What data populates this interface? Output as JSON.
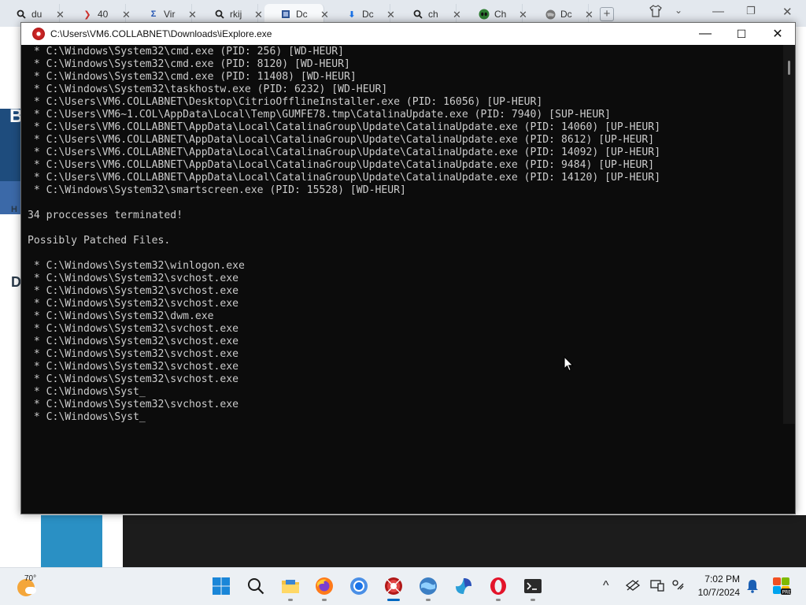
{
  "browser": {
    "tabs": [
      {
        "icon": "search-icon",
        "title": "du",
        "active": false
      },
      {
        "icon": "virustotal-icon",
        "title": "40",
        "active": false
      },
      {
        "icon": "sigma-icon",
        "title": "Vir",
        "active": false
      },
      {
        "icon": "search-icon",
        "title": "rkij",
        "active": false
      },
      {
        "icon": "document-icon",
        "title": "Dc",
        "active": true
      },
      {
        "icon": "download-icon",
        "title": "Dc",
        "active": false
      },
      {
        "icon": "search-icon",
        "title": "ch",
        "active": false
      },
      {
        "icon": "alien-icon",
        "title": "Ch",
        "active": false
      },
      {
        "icon": "globe-icon",
        "title": "Dc",
        "active": false
      }
    ],
    "new_tab_icon": "plus-icon"
  },
  "background_page": {
    "letters": [
      "B",
      "H",
      "D"
    ]
  },
  "console_window": {
    "title": "C:\\Users\\VM6.COLLABNET\\Downloads\\iExplore.exe",
    "controls": {
      "minimize": "—",
      "maximize": "☐",
      "close": "✕"
    },
    "lines": [
      " * C:\\Windows\\System32\\cmd.exe (PID: 256) [WD-HEUR]",
      " * C:\\Windows\\System32\\cmd.exe (PID: 8120) [WD-HEUR]",
      " * C:\\Windows\\System32\\cmd.exe (PID: 11408) [WD-HEUR]",
      " * C:\\Windows\\System32\\taskhostw.exe (PID: 6232) [WD-HEUR]",
      " * C:\\Users\\VM6.COLLABNET\\Desktop\\CitrioOfflineInstaller.exe (PID: 16056) [UP-HEUR]",
      " * C:\\Users\\VM6~1.COL\\AppData\\Local\\Temp\\GUMFE78.tmp\\CatalinaUpdate.exe (PID: 7940) [SUP-HEUR]",
      " * C:\\Users\\VM6.COLLABNET\\AppData\\Local\\CatalinaGroup\\Update\\CatalinaUpdate.exe (PID: 14060) [UP-HEUR]",
      " * C:\\Users\\VM6.COLLABNET\\AppData\\Local\\CatalinaGroup\\Update\\CatalinaUpdate.exe (PID: 8612) [UP-HEUR]",
      " * C:\\Users\\VM6.COLLABNET\\AppData\\Local\\CatalinaGroup\\Update\\CatalinaUpdate.exe (PID: 14092) [UP-HEUR]",
      " * C:\\Users\\VM6.COLLABNET\\AppData\\Local\\CatalinaGroup\\Update\\CatalinaUpdate.exe (PID: 9484) [UP-HEUR]",
      " * C:\\Users\\VM6.COLLABNET\\AppData\\Local\\CatalinaGroup\\Update\\CatalinaUpdate.exe (PID: 14120) [UP-HEUR]",
      " * C:\\Windows\\System32\\smartscreen.exe (PID: 15528) [WD-HEUR]",
      "",
      "34 proccesses terminated!",
      "",
      "Possibly Patched Files.",
      "",
      " * C:\\Windows\\System32\\winlogon.exe",
      " * C:\\Windows\\System32\\svchost.exe",
      " * C:\\Windows\\System32\\svchost.exe",
      " * C:\\Windows\\System32\\svchost.exe",
      " * C:\\Windows\\System32\\dwm.exe",
      " * C:\\Windows\\System32\\svchost.exe",
      " * C:\\Windows\\System32\\svchost.exe",
      " * C:\\Windows\\System32\\svchost.exe",
      " * C:\\Windows\\System32\\svchost.exe",
      " * C:\\Windows\\System32\\svchost.exe",
      " * C:\\Windows\\Syst_",
      " * C:\\Windows\\System32\\svchost.exe",
      " * C:\\Windows\\Syst_"
    ]
  },
  "taskbar": {
    "weather": {
      "icon": "weather-partly-sunny-icon",
      "temperature": "70°"
    },
    "apps": [
      {
        "name": "start-button",
        "icon": "windows-logo-icon",
        "running": false
      },
      {
        "name": "search-button",
        "icon": "search-icon",
        "running": false
      },
      {
        "name": "file-explorer-button",
        "icon": "folder-icon",
        "running": true
      },
      {
        "name": "firefox-button",
        "icon": "firefox-icon",
        "running": true
      },
      {
        "name": "chrome-button",
        "icon": "chrome-icon",
        "running": false
      },
      {
        "name": "iexplore-app-button",
        "icon": "iexplore-app-icon",
        "running": true,
        "active": true
      },
      {
        "name": "browser-globe-button",
        "icon": "globe-icon",
        "running": true
      },
      {
        "name": "copilot-button",
        "icon": "copilot-icon",
        "running": false
      },
      {
        "name": "opera-button",
        "icon": "opera-icon",
        "running": true
      },
      {
        "name": "terminal-button",
        "icon": "terminal-icon",
        "running": true
      }
    ],
    "tray": {
      "chevron": "^",
      "time": "7:02 PM",
      "date": "10/7/2024"
    }
  },
  "colors": {
    "console_bg": "#0c0c0c",
    "console_text": "#cccccc",
    "accent": "#0067c0"
  }
}
